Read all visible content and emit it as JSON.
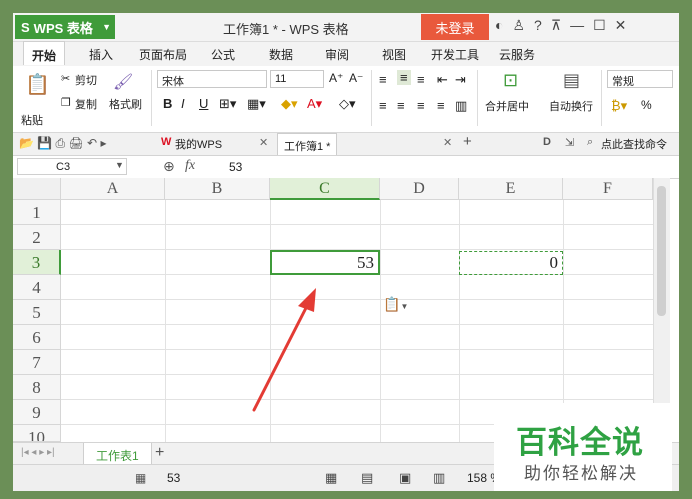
{
  "app": {
    "logo": "S",
    "name": "WPS 表格",
    "doc_title": "工作簿1 * - WPS 表格",
    "login": "未登录"
  },
  "menu": [
    "开始",
    "插入",
    "页面布局",
    "公式",
    "数据",
    "审阅",
    "视图",
    "开发工具",
    "云服务"
  ],
  "ribbon": {
    "paste": "粘贴",
    "cut": "剪切",
    "copy": "复制",
    "format_painter": "格式刷",
    "font_name": "宋体",
    "font_size": "11",
    "merge_center": "合并居中",
    "wrap_text": "自动换行",
    "number_format": "常规",
    "percent": "%"
  },
  "tabs": {
    "mywps": "我的WPS",
    "workbook": "工作簿1 *",
    "find_cmd": "点此查找命令"
  },
  "formula_bar": {
    "name_box": "C3",
    "fx": "fx",
    "value": "53"
  },
  "columns": [
    "A",
    "B",
    "C",
    "D",
    "E",
    "F"
  ],
  "rows": [
    "1",
    "2",
    "3",
    "4",
    "5",
    "6",
    "7",
    "8",
    "9",
    "10"
  ],
  "cells": {
    "C3": "53",
    "E3": "0"
  },
  "sheet": {
    "name": "工作表1",
    "add": "+"
  },
  "status": {
    "value": "53",
    "zoom": "158 %"
  },
  "watermark": {
    "title": "百科全说",
    "subtitle": "助你轻松解决"
  },
  "colors": {
    "accent": "#3f9b3a",
    "login_bg": "#e9593c",
    "arrow": "#e33b34"
  }
}
